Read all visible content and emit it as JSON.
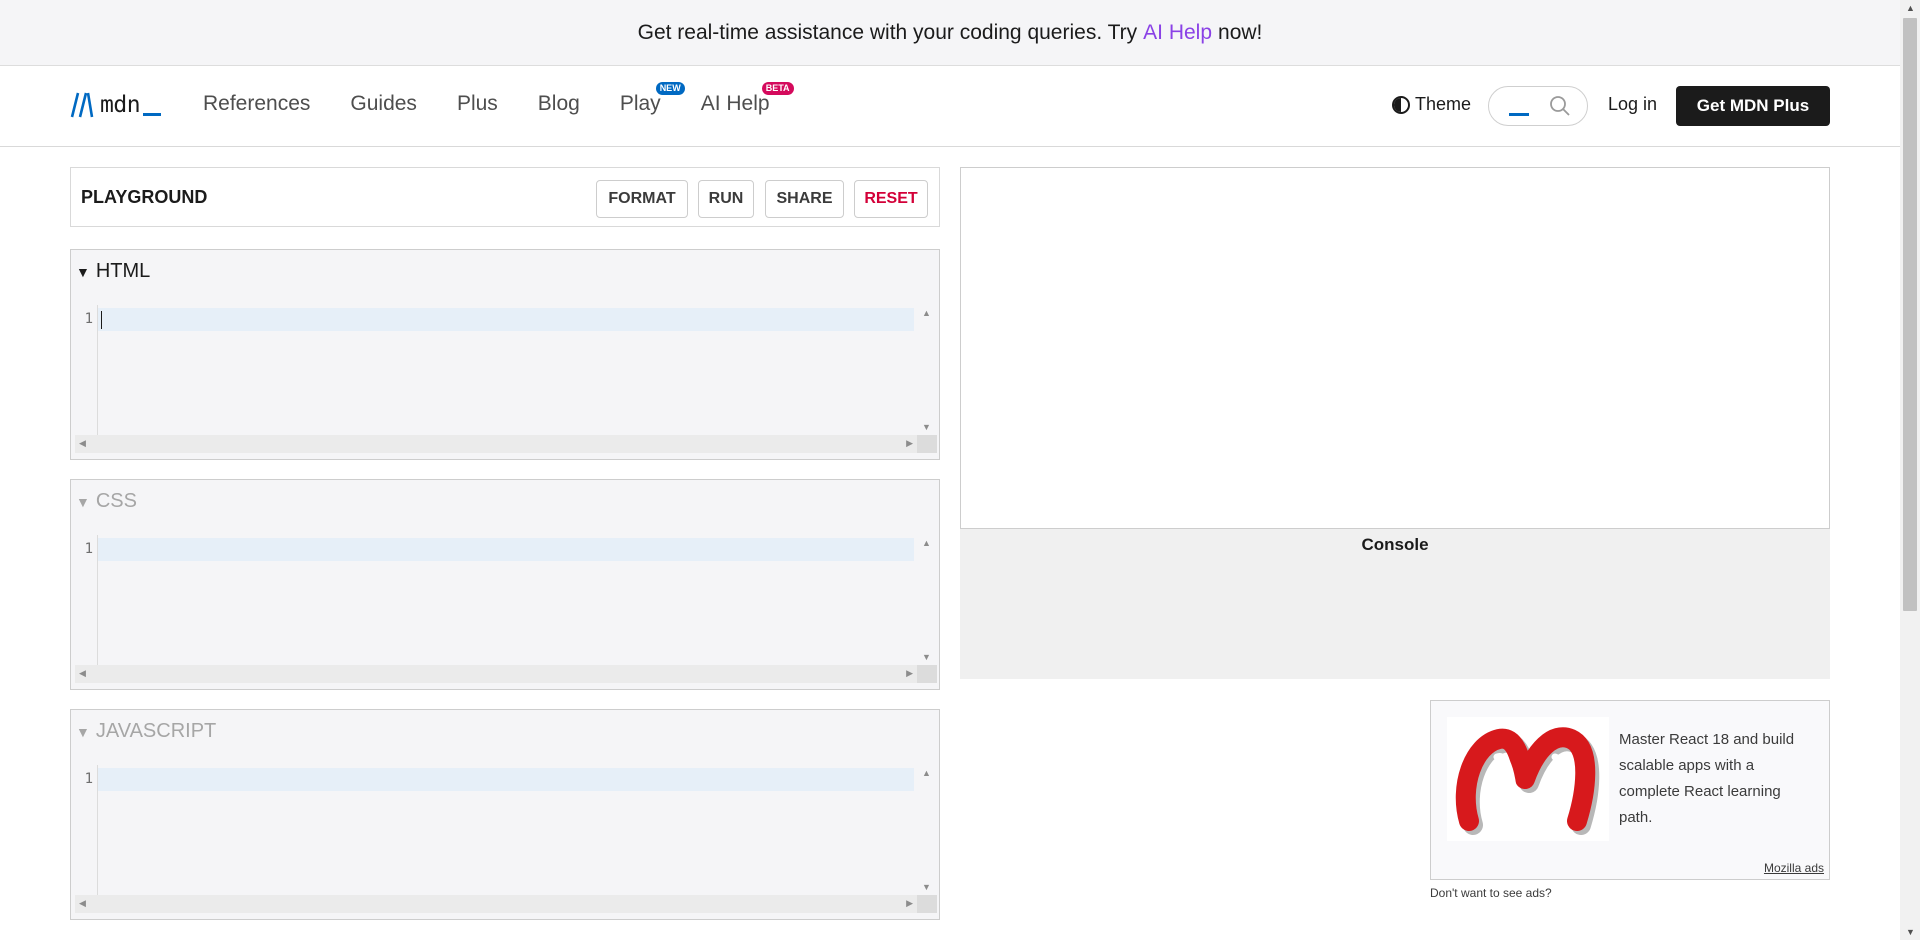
{
  "banner": {
    "text_before": "Get real-time assistance with your coding queries. Try",
    "link": "AI Help",
    "text_after": "now!"
  },
  "header": {
    "logo_text": "mdn",
    "nav": [
      {
        "label": "References"
      },
      {
        "label": "Guides"
      },
      {
        "label": "Plus"
      },
      {
        "label": "Blog"
      },
      {
        "label": "Play",
        "badge": "NEW",
        "badge_color": "#0069c2"
      },
      {
        "label": "AI Help",
        "badge": "BETA",
        "badge_color": "#d40a5c"
      }
    ],
    "theme_label": "Theme",
    "search_icon": "search-icon",
    "login_label": "Log in",
    "cta_label": "Get MDN Plus"
  },
  "playground": {
    "title": "PLAYGROUND",
    "buttons": {
      "format": "FORMAT",
      "run": "RUN",
      "share": "SHARE",
      "reset": "RESET"
    },
    "reset_color": "#d30038"
  },
  "editors": [
    {
      "label": "HTML",
      "line": "1",
      "expanded": true
    },
    {
      "label": "CSS",
      "line": "1",
      "expanded": false
    },
    {
      "label": "JAVASCRIPT",
      "line": "1",
      "expanded": false
    }
  ],
  "console": {
    "title": "Console"
  },
  "ad": {
    "text": "Master React 18 and build scalable apps with a complete React learning path.",
    "attribution": "Mozilla ads",
    "logo_color": "#d7191c",
    "no_ads": "Don't want to see ads?"
  }
}
